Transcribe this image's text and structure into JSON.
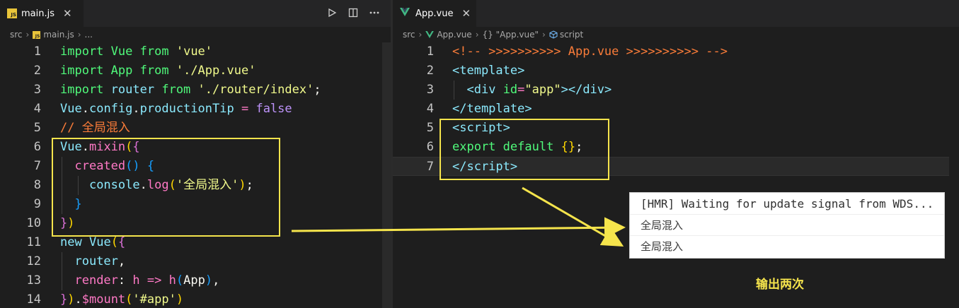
{
  "left_editor": {
    "tab": {
      "title": "main.js",
      "close": "✕",
      "file_badge": "JS"
    },
    "actions": [
      "run-icon",
      "split-editor-icon",
      "more-icon"
    ],
    "breadcrumb": {
      "folder": "src",
      "file": "main.js",
      "rest": "..."
    },
    "lines": [
      {
        "n": "1",
        "html": "<span class='g'>import</span> <span class='g'>Vue</span> <span class='g'>from</span> <span class='y'>'vue'</span>"
      },
      {
        "n": "2",
        "html": "<span class='g'>import</span> <span class='g'>App</span> <span class='g'>from</span> <span class='y'>'./App.vue'</span>"
      },
      {
        "n": "3",
        "html": "<span class='g'>import</span> <span class='cy'>router</span> <span class='g'>from</span> <span class='y'>'./router/index'</span><span class='wh'>;</span>"
      },
      {
        "n": "4",
        "html": "<span class='cy'>Vue</span><span class='wh'>.</span><span class='cy'>config</span><span class='wh'>.</span><span class='cy'>productionTip</span> <span class='pk'>=</span> <span class='pu'>false</span>"
      },
      {
        "n": "5",
        "html": "<span class='cm'>// 全局混入</span>"
      },
      {
        "n": "6",
        "html": "<span class='cy'>Vue</span><span class='wh'>.</span><span class='pk'>mixin</span><span class='br1'>(</span><span class='br2'>{</span>"
      },
      {
        "n": "7",
        "html": "  <span class='pk'>created</span><span class='br3'>()</span> <span class='br3'>{</span>"
      },
      {
        "n": "8",
        "html": "    <span class='cy'>console</span><span class='wh'>.</span><span class='pk'>log</span><span class='br1'>(</span><span class='y'>'全局混入'</span><span class='br1'>)</span><span class='wh'>;</span>"
      },
      {
        "n": "9",
        "html": "  <span class='br3'>}</span>"
      },
      {
        "n": "10",
        "html": "<span class='br2'>}</span><span class='br1'>)</span>"
      },
      {
        "n": "11",
        "html": "<span class='cy'>new</span> <span class='cy'>Vue</span><span class='br1'>(</span><span class='br2'>{</span>"
      },
      {
        "n": "12",
        "html": "  <span class='cy'>router</span><span class='wh'>,</span>"
      },
      {
        "n": "13",
        "html": "  <span class='pk'>render</span><span class='wh'>:</span> <span class='pk'>h</span> <span class='pk'>=&gt;</span> <span class='pk'>h</span><span class='br3'>(</span><span class='wh'>App</span><span class='br3'>)</span><span class='wh'>,</span>"
      },
      {
        "n": "14",
        "html": "<span class='br2'>}</span><span class='br1'>)</span><span class='wh'>.</span><span class='pk'>$mount</span><span class='br1'>(</span><span class='y'>'#app'</span><span class='br1'>)</span>"
      }
    ]
  },
  "right_editor": {
    "tab": {
      "title": "App.vue",
      "close": "✕"
    },
    "breadcrumb": {
      "folder": "src",
      "file": "App.vue",
      "section": "{} \"App.vue\"",
      "node": "script"
    },
    "lines": [
      {
        "n": "1",
        "html": "<span class='cm'>&lt;!-- &gt;&gt;&gt;&gt;&gt;&gt;&gt;&gt;&gt;&gt; App.vue &gt;&gt;&gt;&gt;&gt;&gt;&gt;&gt;&gt;&gt; --&gt;</span>"
      },
      {
        "n": "2",
        "html": "<span class='cy'>&lt;template&gt;</span>"
      },
      {
        "n": "3",
        "html": "  <span class='cy'>&lt;div</span> <span class='g'>id</span><span class='pk'>=</span><span class='y'>\"app\"</span><span class='cy'>&gt;&lt;/div&gt;</span>"
      },
      {
        "n": "4",
        "html": "<span class='cy'>&lt;/template&gt;</span>"
      },
      {
        "n": "5",
        "html": "<span class='cy'>&lt;script&gt;</span>"
      },
      {
        "n": "6",
        "html": "<span class='g'>export</span> <span class='g'>default</span> <span class='br1'>{}</span><span class='wh'>;</span>"
      },
      {
        "n": "7",
        "html": "<span class='cy'>&lt;/script&gt;</span>"
      }
    ]
  },
  "console": {
    "lines": [
      "[HMR] Waiting for update signal from WDS...",
      "全局混入",
      "全局混入"
    ]
  },
  "annotation": {
    "text": "输出两次",
    "color": "#f5e44c"
  }
}
